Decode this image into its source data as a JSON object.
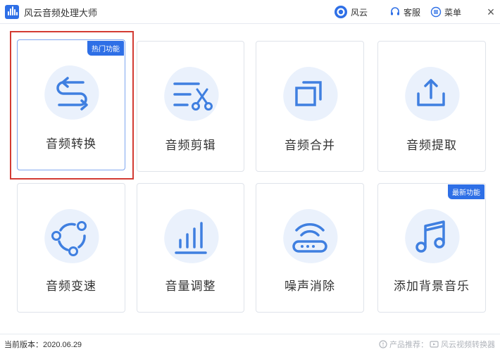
{
  "window": {
    "title": "风云音频处理大师"
  },
  "titlebar": {
    "brand_label": "风云",
    "service_label": "客服",
    "menu_label": "菜单",
    "close_glyph": "×"
  },
  "cards": [
    {
      "label": "音频转换",
      "icon": "convert-arrows-icon",
      "badge": "热门功能"
    },
    {
      "label": "音频剪辑",
      "icon": "scissors-icon"
    },
    {
      "label": "音频合并",
      "icon": "merge-squares-icon"
    },
    {
      "label": "音频提取",
      "icon": "upload-tray-icon"
    },
    {
      "label": "音频变速",
      "icon": "speed-circle-icon"
    },
    {
      "label": "音量调整",
      "icon": "volume-bars-icon"
    },
    {
      "label": "噪声消除",
      "icon": "noise-router-icon"
    },
    {
      "label": "添加背景音乐",
      "icon": "music-note-icon",
      "badge": "最新功能"
    }
  ],
  "statusbar": {
    "version_text": "当前版本：2020.06.29",
    "recommend_label": "产品推荐：",
    "recommend_product": "风云视频转换器"
  },
  "colors": {
    "accent": "#2e6fe6",
    "icon_blue": "#3f7fe0",
    "blob": "#eaf1fc",
    "selection": "#d33b33"
  }
}
